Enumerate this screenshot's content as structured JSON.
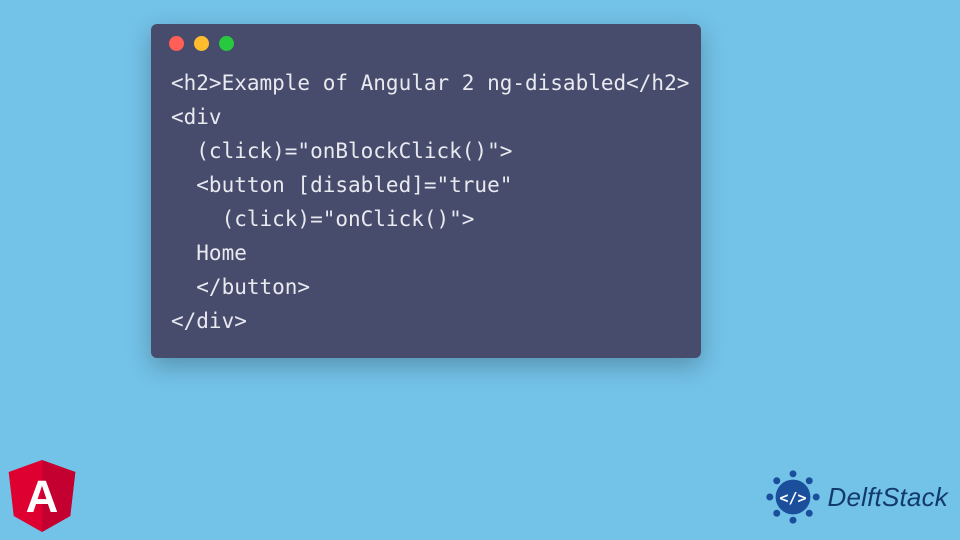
{
  "code_lines": [
    "<h2>Example of Angular 2 ng-disabled</h2>",
    "<div",
    "  (click)=\"onBlockClick()\">",
    "  <button [disabled]=\"true\"",
    "    (click)=\"onClick()\">",
    "  Home",
    "  </button>",
    "</div>"
  ],
  "brand": {
    "name": "DelftStack",
    "angular_letter": "A"
  },
  "colors": {
    "bg": "#73c2e8",
    "window": "#474c6c",
    "text": "#e9eaf0",
    "dot_red": "#ff5f56",
    "dot_yellow": "#ffbd2e",
    "dot_green": "#27c93f",
    "brand_blue": "#123a6b",
    "angular_red": "#dd0031",
    "angular_dark": "#c3002f"
  }
}
